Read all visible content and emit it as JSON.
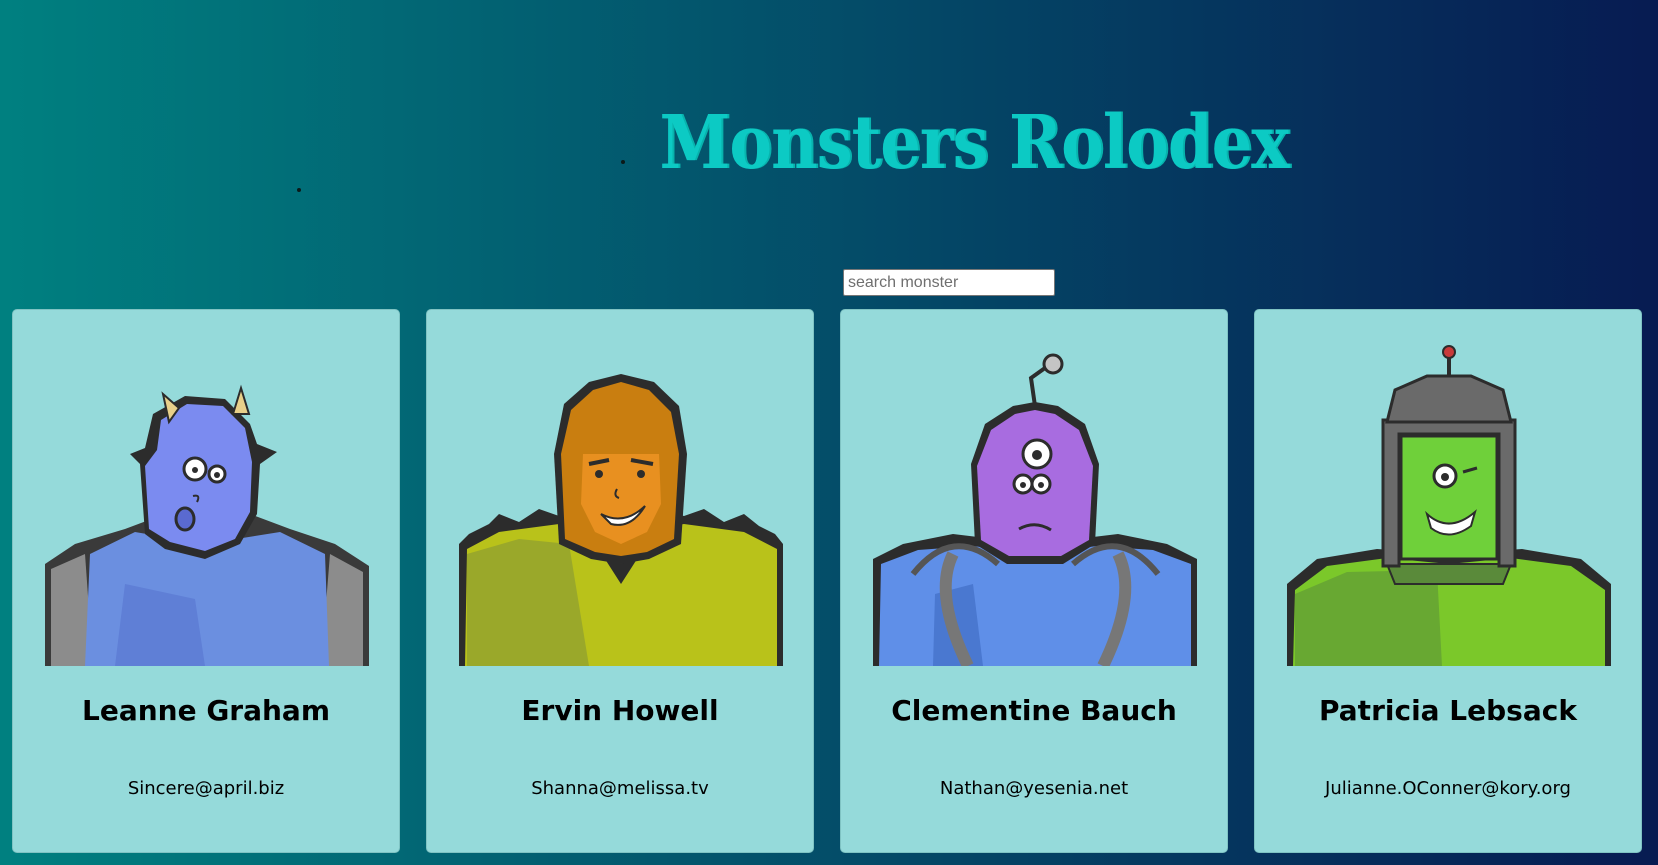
{
  "app": {
    "title": "Monsters Rolodex"
  },
  "search": {
    "placeholder": "search monster",
    "value": ""
  },
  "colors": {
    "title": "#0ccac4",
    "card_background": "#95dada",
    "gradient_start": "#008080",
    "gradient_end": "#071b52"
  },
  "monsters": [
    {
      "name": "Leanne Graham",
      "email": "Sincere@april.biz",
      "avatar_icon": "blue-horned-monster-icon",
      "skin": "#7b8bf0",
      "body": "#6b8fe0",
      "accent": "#e8d08a"
    },
    {
      "name": "Ervin Howell",
      "email": "Shanna@melissa.tv",
      "avatar_icon": "orange-hooded-monster-icon",
      "skin": "#d98a10",
      "body": "#b9c21a",
      "accent": "#8a6a2a"
    },
    {
      "name": "Clementine Bauch",
      "email": "Nathan@yesenia.net",
      "avatar_icon": "purple-three-eyed-monster-icon",
      "skin": "#a86ce0",
      "body": "#5f8fe8",
      "accent": "#777777"
    },
    {
      "name": "Patricia Lebsack",
      "email": "Julianne.OConner@kory.org",
      "avatar_icon": "green-helmet-monster-icon",
      "skin": "#6fd03a",
      "body": "#7bc82a",
      "accent": "#6a6a6a"
    }
  ]
}
